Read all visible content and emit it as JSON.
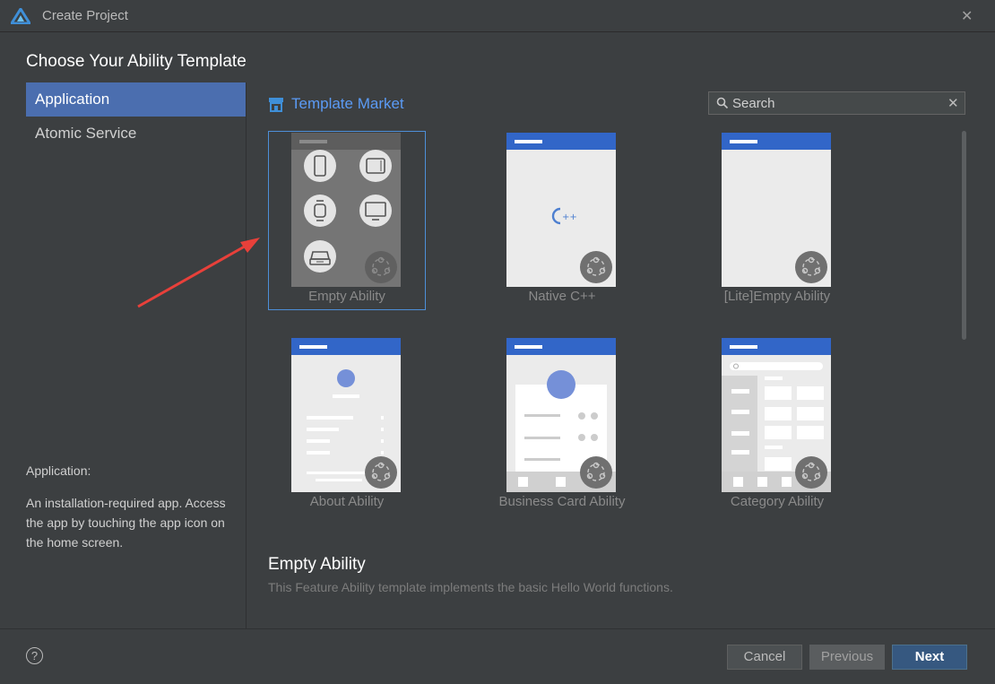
{
  "window": {
    "title": "Create Project"
  },
  "heading": "Choose Your Ability Template",
  "sidebar": {
    "items": [
      {
        "label": "Application",
        "selected": true
      },
      {
        "label": "Atomic Service",
        "selected": false
      }
    ]
  },
  "description": {
    "title": "Application:",
    "body": "An installation-required app. Access the app by touching the app icon on the home screen."
  },
  "market": {
    "label": "Template Market"
  },
  "search": {
    "placeholder": "Search",
    "value": ""
  },
  "templates": [
    {
      "label": "Empty Ability",
      "selected": true
    },
    {
      "label": "Native C++",
      "selected": false
    },
    {
      "label": "[Lite]Empty Ability",
      "selected": false
    },
    {
      "label": "About Ability",
      "selected": false
    },
    {
      "label": "Business Card Ability",
      "selected": false
    },
    {
      "label": "Category Ability",
      "selected": false
    }
  ],
  "detail": {
    "title": "Empty Ability",
    "description": "This Feature Ability template implements the basic Hello World functions."
  },
  "buttons": {
    "cancel": "Cancel",
    "previous": "Previous",
    "next": "Next"
  },
  "colors": {
    "accent": "#4b6eaf",
    "link": "#5b9bf5",
    "primary_button": "#365880",
    "annotation_arrow": "#e8403a"
  }
}
